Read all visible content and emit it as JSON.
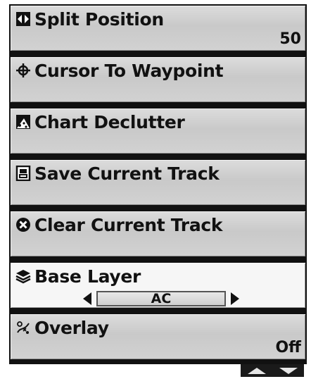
{
  "menu": {
    "items": [
      {
        "label": "Split Position",
        "value": "50",
        "icon": "split-position-icon"
      },
      {
        "label": "Cursor To Waypoint",
        "value": "",
        "icon": "crosshair-icon"
      },
      {
        "label": "Chart Declutter",
        "value": "",
        "icon": "chart-declutter-icon"
      },
      {
        "label": "Save Current Track",
        "value": "",
        "icon": "save-track-icon"
      },
      {
        "label": "Clear Current Track",
        "value": "",
        "icon": "clear-track-icon"
      },
      {
        "label": "Base Layer",
        "value": "AC",
        "icon": "base-layer-icon",
        "selected": true
      },
      {
        "label": "Overlay",
        "value": "Off",
        "icon": "overlay-icon"
      }
    ]
  },
  "colors": {
    "selected_bg": "#f6f6f6",
    "item_bg": "#d2d2d2",
    "border": "#111111"
  }
}
